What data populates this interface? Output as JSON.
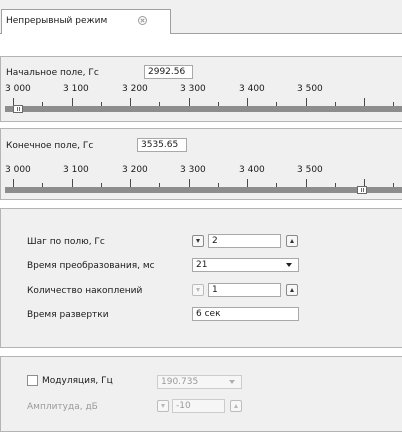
{
  "tab": {
    "label": "Непрерывный режим",
    "close_icon": "close-circle-icon"
  },
  "start_field": {
    "label": "Начальное поле, Гс",
    "value": "2992.56",
    "scale_labels": [
      "3 000",
      "3 100",
      "3 200",
      "3 300",
      "3 400",
      "3 500"
    ]
  },
  "end_field": {
    "label": "Конечное поле, Гс",
    "value": "3535.65",
    "scale_labels": [
      "3 000",
      "3 100",
      "3 200",
      "3 300",
      "3 400",
      "3 500"
    ]
  },
  "params": {
    "step_label": "Шаг по полю, Гс",
    "step_value": "2",
    "conversion_label": "Время преобразования, мс",
    "conversion_value": "21",
    "accum_label": "Количество накоплений",
    "accum_value": "1",
    "sweep_label": "Время развертки",
    "sweep_value": "6 сек"
  },
  "modulation": {
    "checkbox_label": "Модуляция, Гц",
    "checked": false,
    "frequency_value": "190.735",
    "amplitude_label": "Амплитуда, дБ",
    "amplitude_value": "-10"
  },
  "colors": {
    "panel_bg": "#f0f0f0",
    "track": "#8d8d8d",
    "border": "#b4b4b4"
  }
}
